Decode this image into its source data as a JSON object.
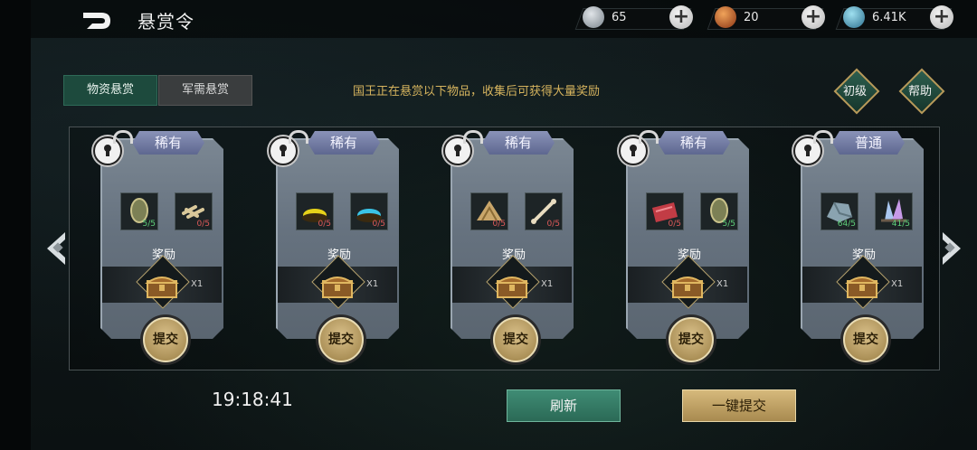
{
  "header": {
    "title": "悬赏令"
  },
  "resources": [
    {
      "icon": "silver-coin-icon",
      "value": "65",
      "color": "#9aa3aa"
    },
    {
      "icon": "orange-emblem-icon",
      "value": "20",
      "color": "#d0652b"
    },
    {
      "icon": "blue-gem-icon",
      "value": "6.41K",
      "color": "#3f8fb3"
    }
  ],
  "tabs": [
    {
      "label": "物资悬赏",
      "active": true
    },
    {
      "label": "军需悬赏",
      "active": false
    }
  ],
  "notice": "国王正在悬赏以下物品，收集后可获得大量奖励",
  "buttons": {
    "beginner": "初级",
    "help": "帮助",
    "refresh": "刷新",
    "submit_all": "一键提交"
  },
  "timer": "19:18:41",
  "cards": [
    {
      "rarity": "稀有",
      "items": [
        {
          "icon": "shield-icon",
          "count": "5/5",
          "complete": true
        },
        {
          "icon": "bones-icon",
          "count": "0/5",
          "complete": false
        }
      ],
      "reward_label": "奖励",
      "reward_icon": "treasure-chest-icon",
      "reward_qty": "X1",
      "submit_label": "提交"
    },
    {
      "rarity": "稀有",
      "items": [
        {
          "icon": "yellow-powder-icon",
          "count": "0/5",
          "complete": false
        },
        {
          "icon": "blue-powder-icon",
          "count": "0/5",
          "complete": false
        }
      ],
      "reward_label": "奖励",
      "reward_icon": "treasure-chest-icon",
      "reward_qty": "X1",
      "submit_label": "提交"
    },
    {
      "rarity": "稀有",
      "items": [
        {
          "icon": "wood-pile-icon",
          "count": "0/5",
          "complete": false
        },
        {
          "icon": "bone-icon",
          "count": "0/5",
          "complete": false
        }
      ],
      "reward_label": "奖励",
      "reward_icon": "treasure-chest-icon",
      "reward_qty": "X1",
      "submit_label": "提交"
    },
    {
      "rarity": "稀有",
      "items": [
        {
          "icon": "red-meat-icon",
          "count": "0/5",
          "complete": false
        },
        {
          "icon": "shield-icon",
          "count": "5/5",
          "complete": true
        }
      ],
      "reward_label": "奖励",
      "reward_icon": "treasure-chest-icon",
      "reward_qty": "X1",
      "submit_label": "提交"
    },
    {
      "rarity": "普通",
      "items": [
        {
          "icon": "stone-icon",
          "count": "64/5",
          "complete": true
        },
        {
          "icon": "crystal-icon",
          "count": "41/5",
          "complete": true
        }
      ],
      "reward_label": "奖励",
      "reward_icon": "treasure-chest-icon",
      "reward_qty": "X1",
      "submit_label": "提交"
    }
  ]
}
